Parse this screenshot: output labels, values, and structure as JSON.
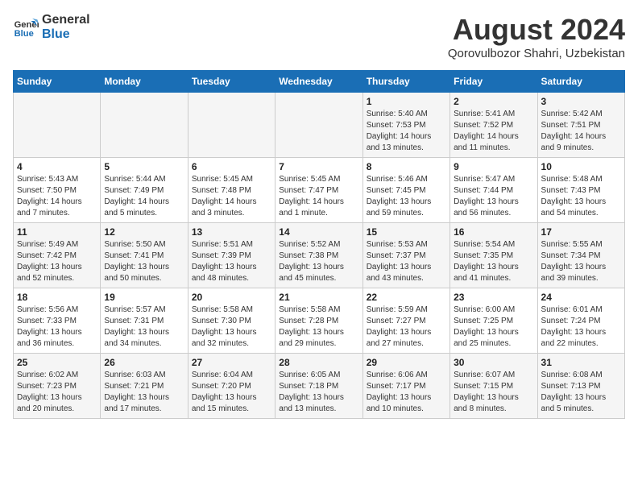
{
  "logo": {
    "line1": "General",
    "line2": "Blue"
  },
  "title": "August 2024",
  "subtitle": "Qorovulbozor Shahri, Uzbekistan",
  "weekdays": [
    "Sunday",
    "Monday",
    "Tuesday",
    "Wednesday",
    "Thursday",
    "Friday",
    "Saturday"
  ],
  "weeks": [
    [
      {
        "day": "",
        "info": ""
      },
      {
        "day": "",
        "info": ""
      },
      {
        "day": "",
        "info": ""
      },
      {
        "day": "",
        "info": ""
      },
      {
        "day": "1",
        "info": "Sunrise: 5:40 AM\nSunset: 7:53 PM\nDaylight: 14 hours\nand 13 minutes."
      },
      {
        "day": "2",
        "info": "Sunrise: 5:41 AM\nSunset: 7:52 PM\nDaylight: 14 hours\nand 11 minutes."
      },
      {
        "day": "3",
        "info": "Sunrise: 5:42 AM\nSunset: 7:51 PM\nDaylight: 14 hours\nand 9 minutes."
      }
    ],
    [
      {
        "day": "4",
        "info": "Sunrise: 5:43 AM\nSunset: 7:50 PM\nDaylight: 14 hours\nand 7 minutes."
      },
      {
        "day": "5",
        "info": "Sunrise: 5:44 AM\nSunset: 7:49 PM\nDaylight: 14 hours\nand 5 minutes."
      },
      {
        "day": "6",
        "info": "Sunrise: 5:45 AM\nSunset: 7:48 PM\nDaylight: 14 hours\nand 3 minutes."
      },
      {
        "day": "7",
        "info": "Sunrise: 5:45 AM\nSunset: 7:47 PM\nDaylight: 14 hours\nand 1 minute."
      },
      {
        "day": "8",
        "info": "Sunrise: 5:46 AM\nSunset: 7:45 PM\nDaylight: 13 hours\nand 59 minutes."
      },
      {
        "day": "9",
        "info": "Sunrise: 5:47 AM\nSunset: 7:44 PM\nDaylight: 13 hours\nand 56 minutes."
      },
      {
        "day": "10",
        "info": "Sunrise: 5:48 AM\nSunset: 7:43 PM\nDaylight: 13 hours\nand 54 minutes."
      }
    ],
    [
      {
        "day": "11",
        "info": "Sunrise: 5:49 AM\nSunset: 7:42 PM\nDaylight: 13 hours\nand 52 minutes."
      },
      {
        "day": "12",
        "info": "Sunrise: 5:50 AM\nSunset: 7:41 PM\nDaylight: 13 hours\nand 50 minutes."
      },
      {
        "day": "13",
        "info": "Sunrise: 5:51 AM\nSunset: 7:39 PM\nDaylight: 13 hours\nand 48 minutes."
      },
      {
        "day": "14",
        "info": "Sunrise: 5:52 AM\nSunset: 7:38 PM\nDaylight: 13 hours\nand 45 minutes."
      },
      {
        "day": "15",
        "info": "Sunrise: 5:53 AM\nSunset: 7:37 PM\nDaylight: 13 hours\nand 43 minutes."
      },
      {
        "day": "16",
        "info": "Sunrise: 5:54 AM\nSunset: 7:35 PM\nDaylight: 13 hours\nand 41 minutes."
      },
      {
        "day": "17",
        "info": "Sunrise: 5:55 AM\nSunset: 7:34 PM\nDaylight: 13 hours\nand 39 minutes."
      }
    ],
    [
      {
        "day": "18",
        "info": "Sunrise: 5:56 AM\nSunset: 7:33 PM\nDaylight: 13 hours\nand 36 minutes."
      },
      {
        "day": "19",
        "info": "Sunrise: 5:57 AM\nSunset: 7:31 PM\nDaylight: 13 hours\nand 34 minutes."
      },
      {
        "day": "20",
        "info": "Sunrise: 5:58 AM\nSunset: 7:30 PM\nDaylight: 13 hours\nand 32 minutes."
      },
      {
        "day": "21",
        "info": "Sunrise: 5:58 AM\nSunset: 7:28 PM\nDaylight: 13 hours\nand 29 minutes."
      },
      {
        "day": "22",
        "info": "Sunrise: 5:59 AM\nSunset: 7:27 PM\nDaylight: 13 hours\nand 27 minutes."
      },
      {
        "day": "23",
        "info": "Sunrise: 6:00 AM\nSunset: 7:25 PM\nDaylight: 13 hours\nand 25 minutes."
      },
      {
        "day": "24",
        "info": "Sunrise: 6:01 AM\nSunset: 7:24 PM\nDaylight: 13 hours\nand 22 minutes."
      }
    ],
    [
      {
        "day": "25",
        "info": "Sunrise: 6:02 AM\nSunset: 7:23 PM\nDaylight: 13 hours\nand 20 minutes."
      },
      {
        "day": "26",
        "info": "Sunrise: 6:03 AM\nSunset: 7:21 PM\nDaylight: 13 hours\nand 17 minutes."
      },
      {
        "day": "27",
        "info": "Sunrise: 6:04 AM\nSunset: 7:20 PM\nDaylight: 13 hours\nand 15 minutes."
      },
      {
        "day": "28",
        "info": "Sunrise: 6:05 AM\nSunset: 7:18 PM\nDaylight: 13 hours\nand 13 minutes."
      },
      {
        "day": "29",
        "info": "Sunrise: 6:06 AM\nSunset: 7:17 PM\nDaylight: 13 hours\nand 10 minutes."
      },
      {
        "day": "30",
        "info": "Sunrise: 6:07 AM\nSunset: 7:15 PM\nDaylight: 13 hours\nand 8 minutes."
      },
      {
        "day": "31",
        "info": "Sunrise: 6:08 AM\nSunset: 7:13 PM\nDaylight: 13 hours\nand 5 minutes."
      }
    ]
  ]
}
